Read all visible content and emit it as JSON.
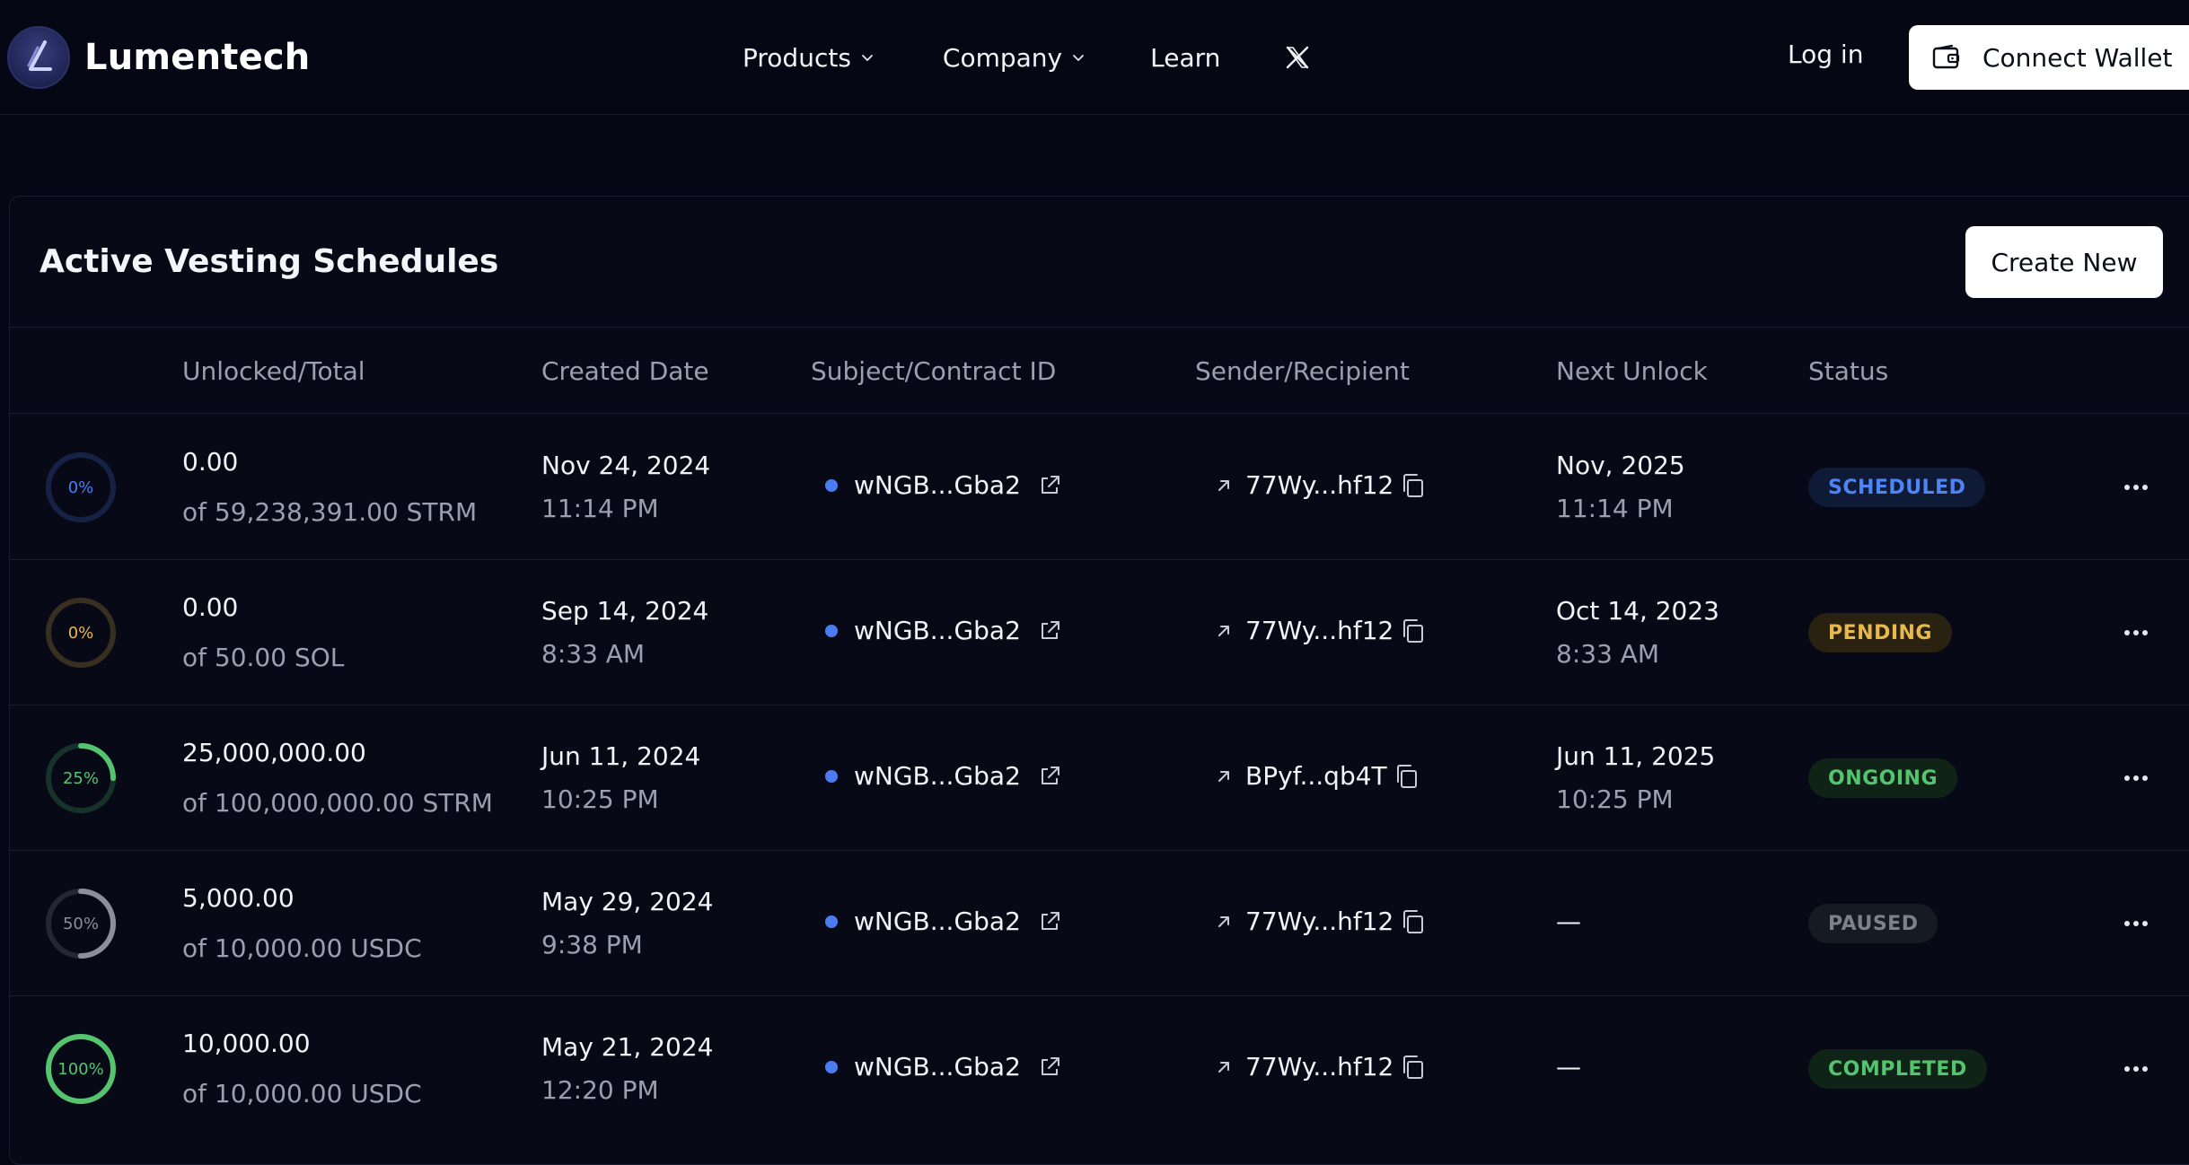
{
  "nav": {
    "brand": "Lumentech",
    "links": [
      {
        "label": "Products"
      },
      {
        "label": "Company"
      },
      {
        "label": "Learn"
      }
    ],
    "x_icon": "x-logo-icon",
    "login": "Log in",
    "connect_wallet": "Connect Wallet"
  },
  "card": {
    "title": "Active Vesting Schedules",
    "create_button": "Create New"
  },
  "table": {
    "headers": {
      "unlocked_total": "Unlocked/Total",
      "created_date": "Created Date",
      "contract_id": "Subject/Contract ID",
      "sender_recipient": "Sender/Recipient",
      "next_unlock": "Next Unlock",
      "status": "Status"
    },
    "rows": [
      {
        "percent_label": "0%",
        "progress": 0.0,
        "ring_color": "#4b7cf3",
        "unlocked": "0.00",
        "total": "of 59,238,391.00 STRM",
        "created_date": "Nov 24, 2024",
        "created_time": "11:14 PM",
        "contract": "wNGB...Gba2",
        "recipient": "77Wy...hf12",
        "next_date": "Nov, 2025",
        "next_time": "11:14 PM",
        "status": "SCHEDULED"
      },
      {
        "percent_label": "0%",
        "progress": 0.0,
        "ring_color": "#e7b84a",
        "unlocked": "0.00",
        "total": "of 50.00 SOL",
        "created_date": "Sep 14, 2024",
        "created_time": "8:33 AM",
        "contract": "wNGB...Gba2",
        "recipient": "77Wy...hf12",
        "next_date": "Oct 14, 2023",
        "next_time": "8:33 AM",
        "status": "PENDING"
      },
      {
        "percent_label": "25%",
        "progress": 0.25,
        "ring_color": "#54c46f",
        "unlocked": "25,000,000.00",
        "total": "of 100,000,000.00 STRM",
        "created_date": "Jun 11, 2024",
        "created_time": "10:25 PM",
        "contract": "wNGB...Gba2",
        "recipient": "BPyf...qb4T",
        "next_date": "Jun 11, 2025",
        "next_time": "10:25 PM",
        "status": "ONGOING"
      },
      {
        "percent_label": "50%",
        "progress": 0.5,
        "ring_color": "#8a8f99",
        "unlocked": "5,000.00",
        "total": "of 10,000.00 USDC",
        "created_date": "May 29, 2024",
        "created_time": "9:38 PM",
        "contract": "wNGB...Gba2",
        "recipient": "77Wy...hf12",
        "next_dash": "—",
        "status": "PAUSED"
      },
      {
        "percent_label": "100%",
        "progress": 1.0,
        "ring_color": "#54c46f",
        "unlocked": "10,000.00",
        "total": "of 10,000.00 USDC",
        "created_date": "May 21, 2024",
        "created_time": "12:20 PM",
        "contract": "wNGB...Gba2",
        "recipient": "77Wy...hf12",
        "next_dash": "—",
        "status": "COMPLETED"
      }
    ]
  }
}
